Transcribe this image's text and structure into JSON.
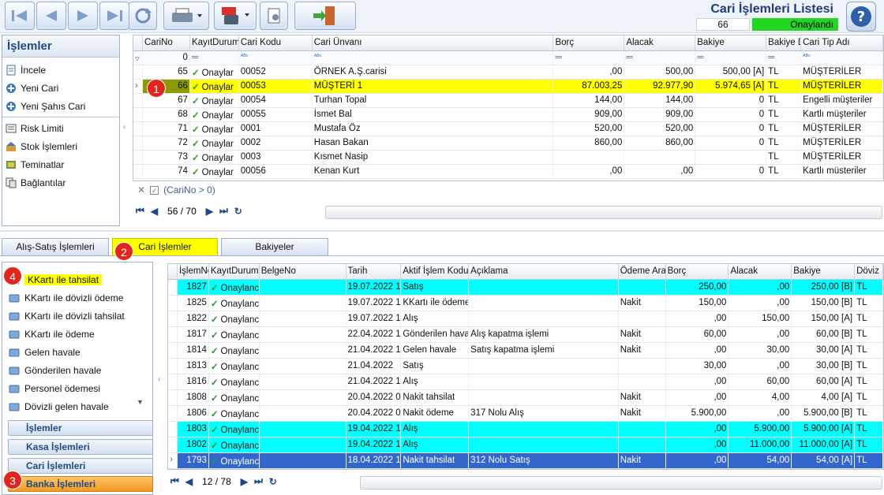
{
  "window": {
    "title": "Cari İşlemleri Listesi",
    "record_count": "66",
    "status": "Onaylandı"
  },
  "toolbar": {
    "icons": [
      "first-icon",
      "prev-icon",
      "next-icon",
      "last-icon",
      "refresh-icon",
      "print-icon",
      "pdf-save-icon",
      "settings-icon",
      "exit-icon",
      "help-icon"
    ]
  },
  "left_panel": {
    "header": "İşlemler",
    "items": [
      "İncele",
      "Yeni Cari",
      "Yeni Şahıs Cari"
    ],
    "items2": [
      "Risk Limiti",
      "Stok İşlemleri",
      "Teminatlar",
      "Bağlantılar"
    ]
  },
  "top_grid": {
    "columns": [
      "CariNo",
      "KayıtDurumu",
      "Cari Kodu",
      "Cari Ünvanı",
      "Borç",
      "Alacak",
      "Bakiye",
      "Bakiye D",
      "Cari Tip Adı"
    ],
    "filter_value": "0",
    "rows": [
      [
        "65",
        "Onaylar",
        "00052",
        "ÖRNEK A.Ş.carisi",
        ",00",
        "500,00",
        "500,00 [A]",
        "TL",
        "MÜŞTERİLER"
      ],
      [
        "66",
        "Onaylar",
        "00053",
        "MÜŞTERİ 1",
        "87.003,25",
        "92.977,90",
        "5.974,65 [A]",
        "TL",
        "MÜŞTERİLER"
      ],
      [
        "67",
        "Onaylar",
        "00054",
        "Turhan Topal",
        "144,00",
        "144,00",
        "0",
        "TL",
        "Engelli müşteriler"
      ],
      [
        "68",
        "Onaylar",
        "00055",
        "İsmet Bal",
        "909,00",
        "909,00",
        "0",
        "TL",
        "Kartlı müşteriler"
      ],
      [
        "71",
        "Onaylar",
        "0001",
        "Mustafa Öz",
        "520,00",
        "520,00",
        "0",
        "TL",
        "MÜŞTERİLER"
      ],
      [
        "72",
        "Onaylar",
        "0002",
        "Hasan Bakan",
        "860,00",
        "860,00",
        "0",
        "TL",
        "MÜŞTERİLER"
      ],
      [
        "73",
        "Onaylar",
        "0003",
        "Kısmet Nasip",
        "",
        "",
        "",
        "TL",
        "MÜŞTERİLER"
      ],
      [
        "74",
        "Onaylar",
        "00056",
        "Kenan Kurt",
        ",00",
        ",00",
        "0",
        "TL",
        "Kartlı müsteriler"
      ]
    ],
    "filter_text": "(CariNo > 0)",
    "pager": "56 / 70"
  },
  "tabs": [
    "Alış-Satış İşlemleri",
    "Cari İşlemler",
    "Bakiyeler"
  ],
  "bottom_left": {
    "items": [
      "KKartı ile tahsilat",
      "KKartı ile dövizli ödeme",
      "KKartı ile dövizli tahsilat",
      "KKartı ile ödeme",
      "Gelen havale",
      "Gönderilen havale",
      "Personel ödemesi",
      "Dövizli gelen havale"
    ],
    "groups": [
      "İşlemler",
      "Kasa İşlemleri",
      "Cari İşlemleri",
      "Banka İşlemleri"
    ]
  },
  "bottom_grid": {
    "columns": [
      "İşlemNo",
      "KayıtDurumu",
      "BelgeNo",
      "Tarih",
      "Aktif İşlem Kodu",
      "Açıklama",
      "Ödeme Aracı",
      "Borç",
      "Alacak",
      "Bakiye",
      "Döviz"
    ],
    "rows": [
      [
        "1827",
        "Onaylanc",
        "",
        "19.07.2022 1",
        "Satış",
        "",
        "",
        "250,00",
        ",00",
        "250,00 [B]",
        "TL"
      ],
      [
        "1825",
        "Onaylanc",
        "",
        "19.07.2022 1",
        "KKartı ile ödeme",
        "",
        "Nakit",
        "150,00",
        ",00",
        "150,00 [B]",
        "TL"
      ],
      [
        "1822",
        "Onaylanc",
        "",
        "19.07.2022 1",
        "Alış",
        "",
        "",
        ",00",
        "150,00",
        "150,00 [A]",
        "TL"
      ],
      [
        "1817",
        "Onaylanc",
        "",
        "22.04.2022 1",
        "Gönderilen havale",
        "Alış kapatma işlemi",
        "Nakit",
        "60,00",
        ",00",
        "60,00 [B]",
        "TL"
      ],
      [
        "1814",
        "Onaylanc",
        "",
        "21.04.2022 1",
        "Gelen havale",
        "Satış kapatma işlemi",
        "Nakit",
        ",00",
        "30,00",
        "30,00 [A]",
        "TL"
      ],
      [
        "1813",
        "Onaylanc",
        "",
        "21.04.2022",
        "Satış",
        "",
        "",
        "30,00",
        ",00",
        "30,00 [B]",
        "TL"
      ],
      [
        "1816",
        "Onaylanc",
        "",
        "21.04.2022 1",
        "Alış",
        "",
        "",
        ",00",
        "60,00",
        "60,00 [A]",
        "TL"
      ],
      [
        "1808",
        "Onaylanc",
        "",
        "20.04.2022 0",
        "Nakit tahsilat",
        "",
        "Nakit",
        ",00",
        "4,00",
        "4,00 [A]",
        "TL"
      ],
      [
        "1806",
        "Onaylanc",
        "",
        "20.04.2022 0",
        "Nakit ödeme",
        "317 Nolu Alış",
        "Nakit",
        "5.900,00",
        ",00",
        "5.900,00 [B]",
        "TL"
      ],
      [
        "1803",
        "Onaylanc",
        "",
        "19.04.2022 1",
        "Alış",
        "",
        "",
        ",00",
        "5.900,00",
        "5.900,00 [A]",
        "TL"
      ],
      [
        "1802",
        "Onaylanc",
        "",
        "19.04.2022 1",
        "Alış",
        "",
        "",
        ",00",
        "11.000,00",
        "11.000,00 [A]",
        "TL"
      ],
      [
        "1793",
        "Onaylanc",
        "",
        "18.04.2022 1",
        "Nakit tahsilat",
        "312 Nolu Satış",
        "Nakit",
        ",00",
        "54,00",
        "54,00 [A]",
        "TL"
      ]
    ],
    "pager": "12 / 78"
  },
  "markers": [
    "1",
    "2",
    "3",
    "4"
  ]
}
